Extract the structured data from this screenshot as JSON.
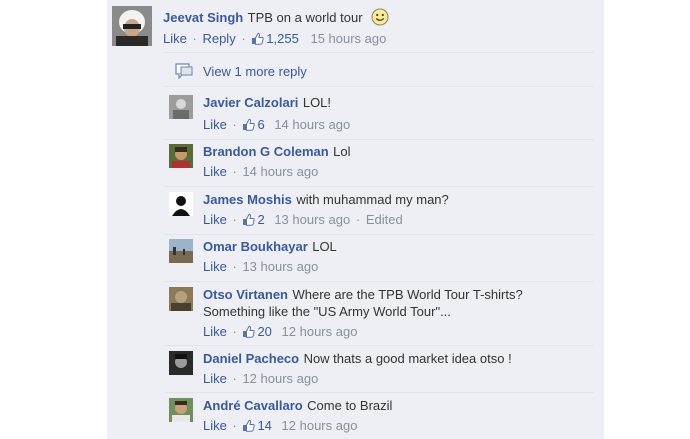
{
  "top_comment": {
    "author": "Jeevat Singh",
    "text": "TPB on a world tour",
    "like": "Like",
    "reply": "Reply",
    "likes": "1,255",
    "time": "15 hours ago"
  },
  "view_more": "View 1 more reply",
  "replies": [
    {
      "author": "Javier Calzolari",
      "text": "LOL!",
      "like": "Like",
      "likes": "6",
      "time": "14 hours ago"
    },
    {
      "author": "Brandon G Coleman",
      "text": "Lol",
      "like": "Like",
      "time": "14 hours ago"
    },
    {
      "author": "James Moshis",
      "text": "with muhammad my man?",
      "like": "Like",
      "likes": "2",
      "time": "13 hours ago",
      "edited": "Edited"
    },
    {
      "author": "Omar Boukhayar",
      "text": "LOL",
      "like": "Like",
      "time": "13 hours ago"
    },
    {
      "author": "Otso Virtanen",
      "text": "Where are the TPB World Tour T-shirts?",
      "text2": "Something like the \"US Army World Tour\"...",
      "like": "Like",
      "likes": "20",
      "time": "12 hours ago"
    },
    {
      "author": "Daniel Pacheco",
      "text": "Now thats a good market idea otso !",
      "like": "Like",
      "time": "12 hours ago"
    },
    {
      "author": "André Cavallaro",
      "text": "Come to Brazil",
      "like": "Like",
      "likes": "14",
      "time": "12 hours ago"
    }
  ],
  "colors": {
    "link": "#3b5998",
    "meta": "#898f9c",
    "panel": "#edeff4"
  }
}
